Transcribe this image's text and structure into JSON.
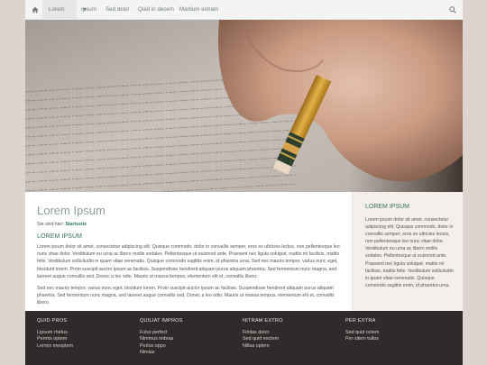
{
  "nav": {
    "items": [
      "Lorem",
      "Ipsum",
      "Sed dolor",
      "Quid in decem",
      "Martium extram"
    ],
    "home_icon": "home-icon",
    "search_icon": "search-icon"
  },
  "hero": {
    "image": "hand-holding-pencil-photo"
  },
  "main": {
    "title": "Lorem Ipsum",
    "breadcrumb_prefix": "Sie sind hier:",
    "breadcrumb_link": "Startseite",
    "section_title": "LOREM IPSUM",
    "paragraphs": [
      "Lorem ipsum dolor sit amet, consectetur adipiscing elit. Quisque commodo, dolor in convallis semper, eros ex ultricies lectus, non pellentesque leo nunc vitae dolor. Vestibulum eu urna ac libero mollis sodales. Pellentesque ut euismod ante. Praesent nec ligula volutpat, mattis mi facilisis, mattis felis. Vestibulum sollicitudin in quam vitae venenatis. Quisque commodo sagittis enim, id pharetra urna. Sed nec mauris tempor, varius nunc eget, tincidunt lorem. Proin suscipit auctor ipsum ac facilisis. Suspendisse hendrerit aliquam purus aliquam pharetra. Sed fermentum nunc magna, sed laoreet augue convallis sed. Donec a leo odio. Mauris ut massa tempus, elementum elit et, convallis libero.",
      "Sed nec mauris tempor, varius nunc eget, tincidunt lorem. Proin suscipit auctor ipsum ac facilisis. Suspendisse hendrerit aliquam purus aliquam pharetra. Sed fermentum nunc magna, sed laoreet augue convallis sed. Donec a leo odio. Mauris ut massa tempus, elementum elit et, convallis libero."
    ]
  },
  "sidebar": {
    "title": "LOREM IPSUM",
    "text": "Lorem ipsum dolor sit amet, consectetur adipiscing elit. Quisque commodo, dolor in convallis semper, eros ex ultricies lectus, non pellentesque leo nunc vitae dolor. Vestibulum eu urna ac libero mollis sodales. Pellentesque ut euismod ante. Praesent nec ligula volutpat, mattis mi facilisis, mattis felis. Vestibulum sollicitudin in quam vitae venenatis. Quisque commodo sagittis enim, id pharetra urna."
  },
  "footer": {
    "columns": [
      {
        "title": "QUID PROS",
        "links": [
          "Lipsum rhetus",
          "Permix optem",
          "Lermix meoptem"
        ]
      },
      {
        "title": "QUILIAT IMPROS",
        "links": [
          "Futur perfect",
          "Nimmus imbras",
          "Perlox oppo",
          "Nimias"
        ]
      },
      {
        "title": "NITRAM EXTRO",
        "links": [
          "Finitas dolor",
          "Sed quid exctem",
          "Nillas optem"
        ]
      },
      {
        "title": "PER EXTRA",
        "links": [
          "Sed quid octem",
          "Per sitem tullos"
        ]
      }
    ]
  },
  "colors": {
    "accent": "#37715e",
    "link": "#2b7a6a",
    "footer_bg": "#2e2b2a",
    "sidebar_bg": "#f4efeb",
    "page_bg": "#ddd4cf"
  }
}
